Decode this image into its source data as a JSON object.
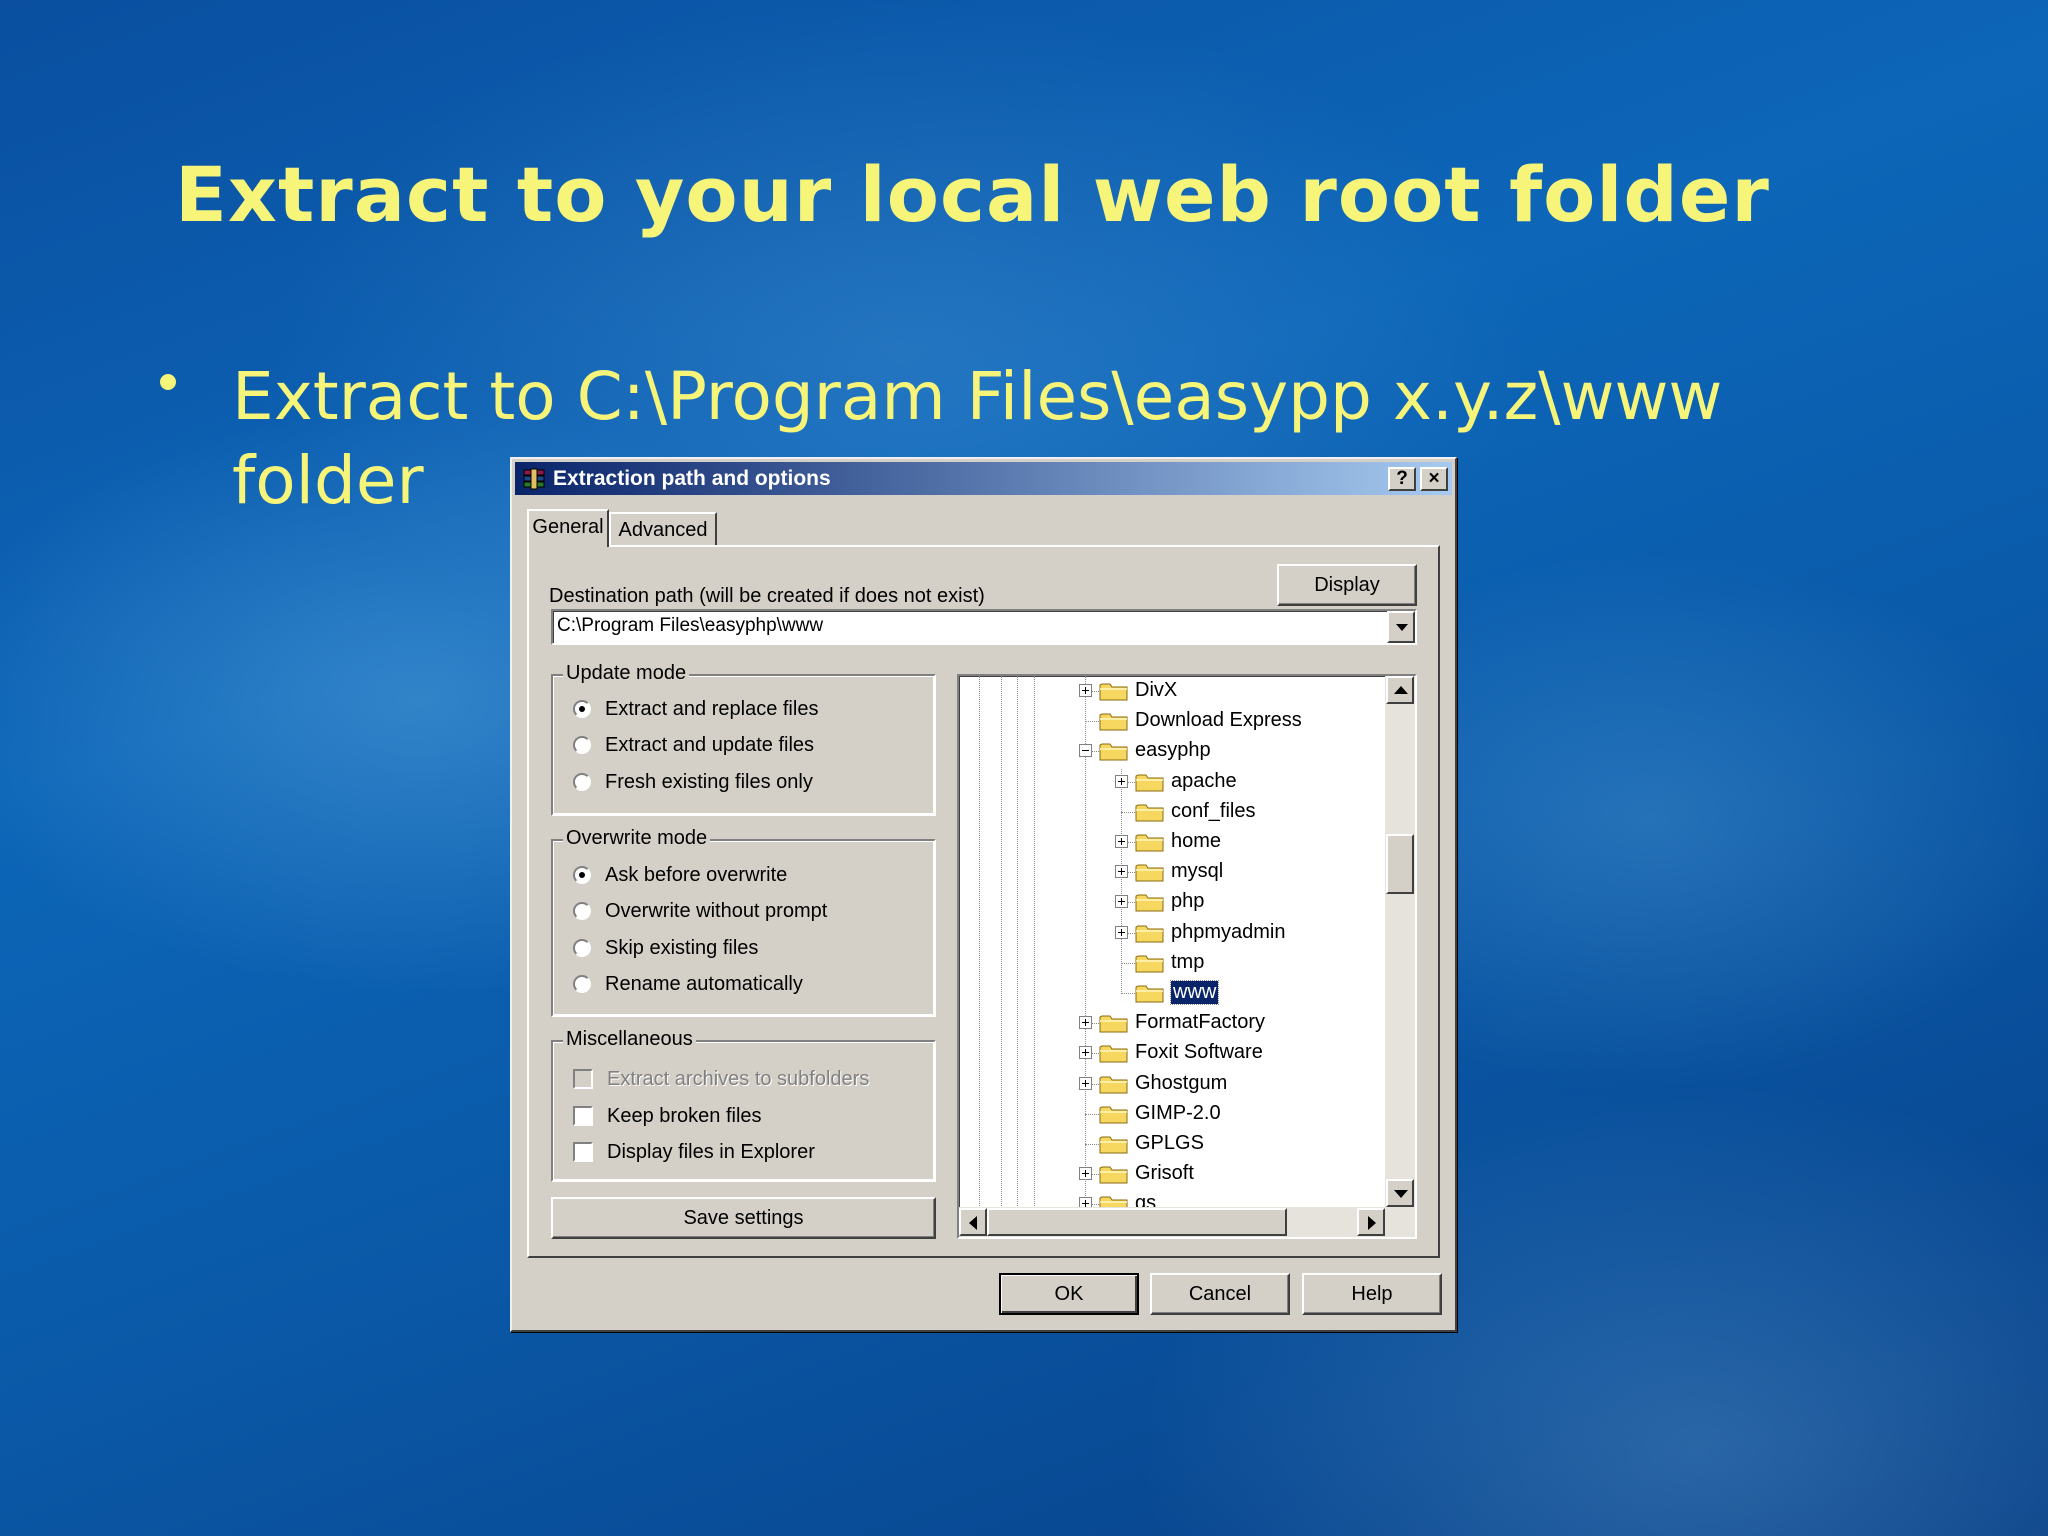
{
  "slide": {
    "title": "Extract to your local web root folder",
    "bullet": "Extract to C:\\Program Files\\easypp x.y.z\\www folder"
  },
  "dialog": {
    "title": "Extraction path and options",
    "help_btn": "?",
    "close_btn": "×",
    "tabs": [
      {
        "label": "General"
      },
      {
        "label": "Advanced"
      }
    ],
    "dest_label": "Destination path (will be created if does not exist)",
    "display_btn": "Display",
    "path_value": "C:\\Program Files\\easyphp\\www",
    "update_mode": {
      "title": "Update mode",
      "options": [
        "Extract and replace files",
        "Extract and update files",
        "Fresh existing files only"
      ],
      "selected": 0
    },
    "overwrite_mode": {
      "title": "Overwrite mode",
      "options": [
        "Ask before overwrite",
        "Overwrite without prompt",
        "Skip existing files",
        "Rename automatically"
      ],
      "selected": 0
    },
    "misc": {
      "title": "Miscellaneous",
      "options": [
        "Extract archives to subfolders",
        "Keep broken files",
        "Display files in Explorer"
      ]
    },
    "save_btn": "Save settings",
    "tree": [
      {
        "label": "DivX",
        "level": 0,
        "exp": "plus"
      },
      {
        "label": "Download Express",
        "level": 0,
        "exp": "none"
      },
      {
        "label": "easyphp",
        "level": 0,
        "exp": "minus"
      },
      {
        "label": "apache",
        "level": 1,
        "exp": "plus"
      },
      {
        "label": "conf_files",
        "level": 1,
        "exp": "none"
      },
      {
        "label": "home",
        "level": 1,
        "exp": "plus"
      },
      {
        "label": "mysql",
        "level": 1,
        "exp": "plus"
      },
      {
        "label": "php",
        "level": 1,
        "exp": "plus"
      },
      {
        "label": "phpmyadmin",
        "level": 1,
        "exp": "plus"
      },
      {
        "label": "tmp",
        "level": 1,
        "exp": "none"
      },
      {
        "label": "www",
        "level": 1,
        "exp": "none",
        "selected": true
      },
      {
        "label": "FormatFactory",
        "level": 0,
        "exp": "plus"
      },
      {
        "label": "Foxit Software",
        "level": 0,
        "exp": "plus"
      },
      {
        "label": "Ghostgum",
        "level": 0,
        "exp": "plus"
      },
      {
        "label": "GIMP-2.0",
        "level": 0,
        "exp": "none"
      },
      {
        "label": "GPLGS",
        "level": 0,
        "exp": "none"
      },
      {
        "label": "Grisoft",
        "level": 0,
        "exp": "plus"
      },
      {
        "label": "gs",
        "level": 0,
        "exp": "plus"
      }
    ],
    "ok_btn": "OK",
    "cancel_btn": "Cancel",
    "help_btn2": "Help"
  }
}
